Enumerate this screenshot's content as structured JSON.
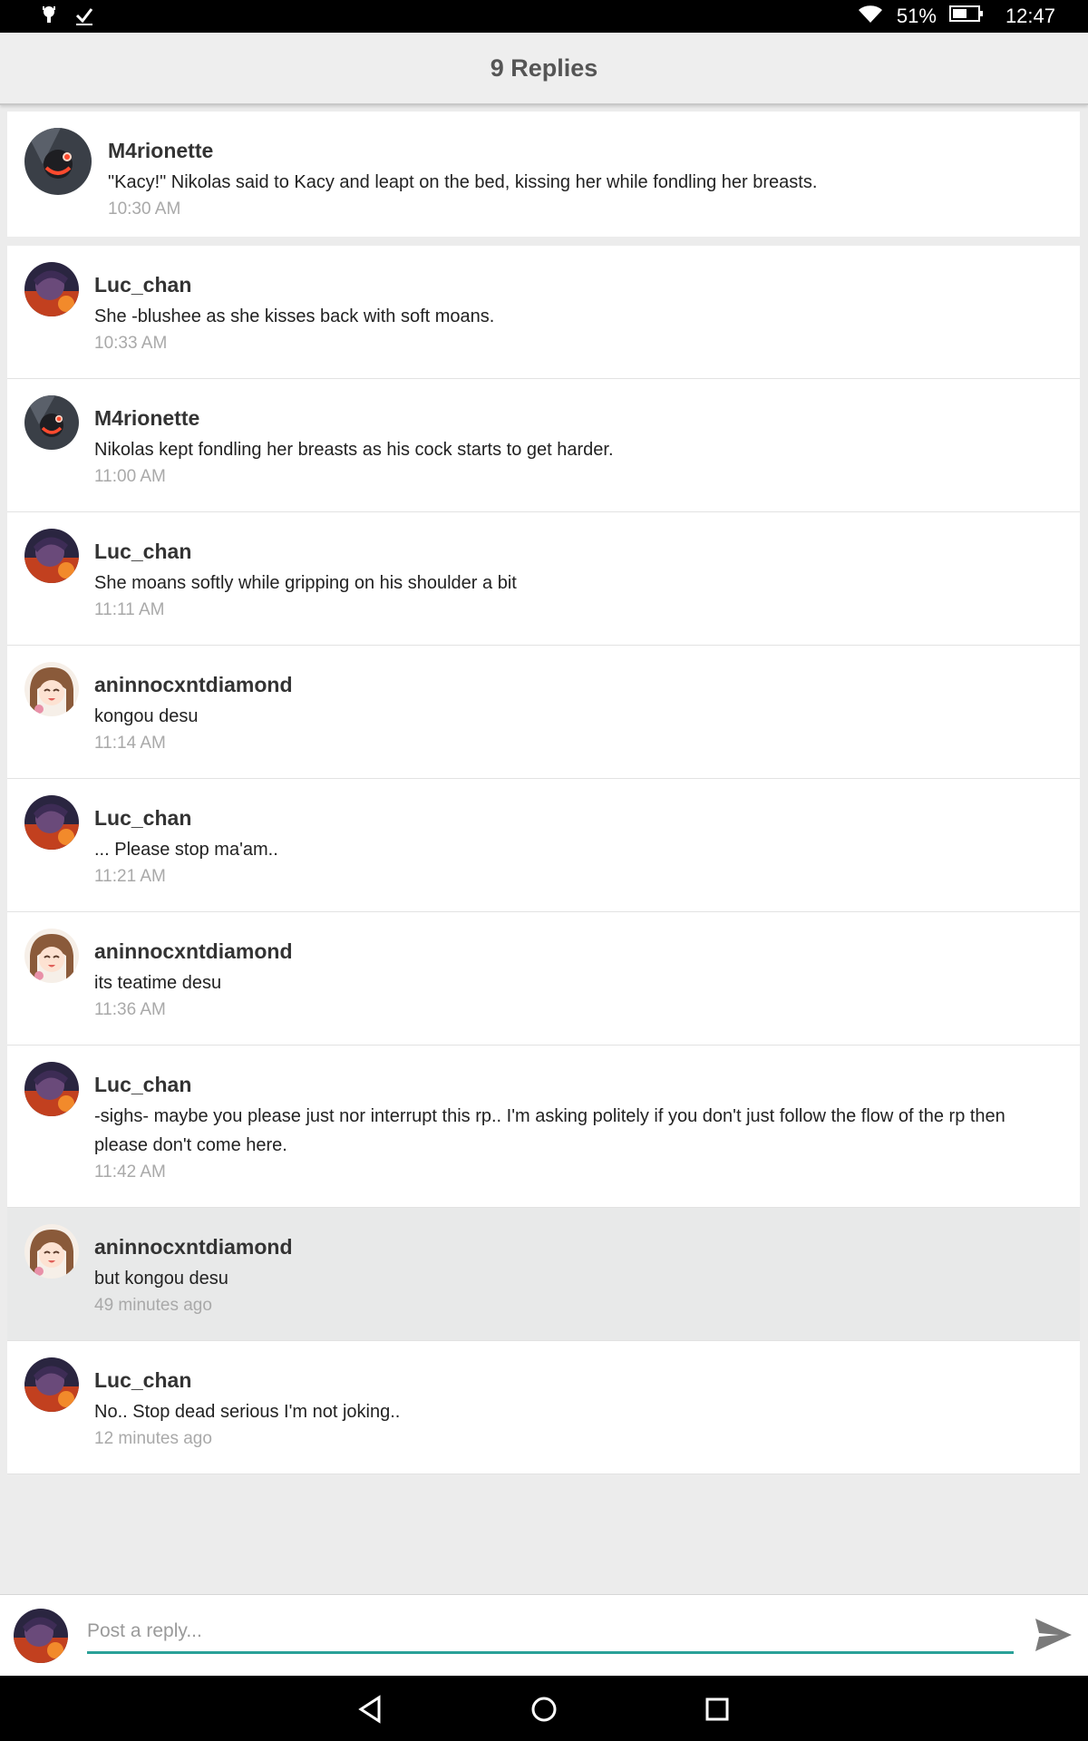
{
  "status_bar": {
    "battery": "51%",
    "time": "12:47",
    "icons": [
      "android-icon",
      "check-icon",
      "wifi-icon",
      "battery-icon"
    ]
  },
  "app_bar": {
    "title": "9 Replies"
  },
  "original_post": {
    "author": "M4rionette",
    "message": "\"Kacy!\" Nikolas said to Kacy and leapt on the bed, kissing her while fondling her breasts.",
    "time": "10:30 AM"
  },
  "replies": [
    {
      "author": "Luc_chan",
      "message": "She -blushee as she kisses back with soft moans.",
      "time": "10:33 AM"
    },
    {
      "author": "M4rionette",
      "message": "Nikolas kept fondling her breasts as his cock starts to get harder.",
      "time": "11:00 AM"
    },
    {
      "author": "Luc_chan",
      "message": "She moans softly while gripping on his shoulder a bit",
      "time": "11:11 AM"
    },
    {
      "author": "aninnocxntdiamond",
      "message": "kongou desu",
      "time": "11:14 AM"
    },
    {
      "author": "Luc_chan",
      "message": "... Please stop ma'am..",
      "time": "11:21 AM"
    },
    {
      "author": "aninnocxntdiamond",
      "message": "its teatime desu",
      "time": "11:36 AM"
    },
    {
      "author": "Luc_chan",
      "message": "-sighs- maybe you please just nor interrupt this rp.. I'm asking politely if you don't just follow the flow of the rp then please don't come here.",
      "time": "11:42 AM"
    },
    {
      "author": "aninnocxntdiamond",
      "message": "but kongou desu",
      "time": "49 minutes ago"
    },
    {
      "author": "Luc_chan",
      "message": "No.. Stop dead serious I'm not joking..",
      "time": "12 minutes ago"
    }
  ],
  "composer": {
    "placeholder": "Post a reply..."
  },
  "colors": {
    "accent": "#2aa198",
    "highlight_row": "#e8e9e9"
  }
}
